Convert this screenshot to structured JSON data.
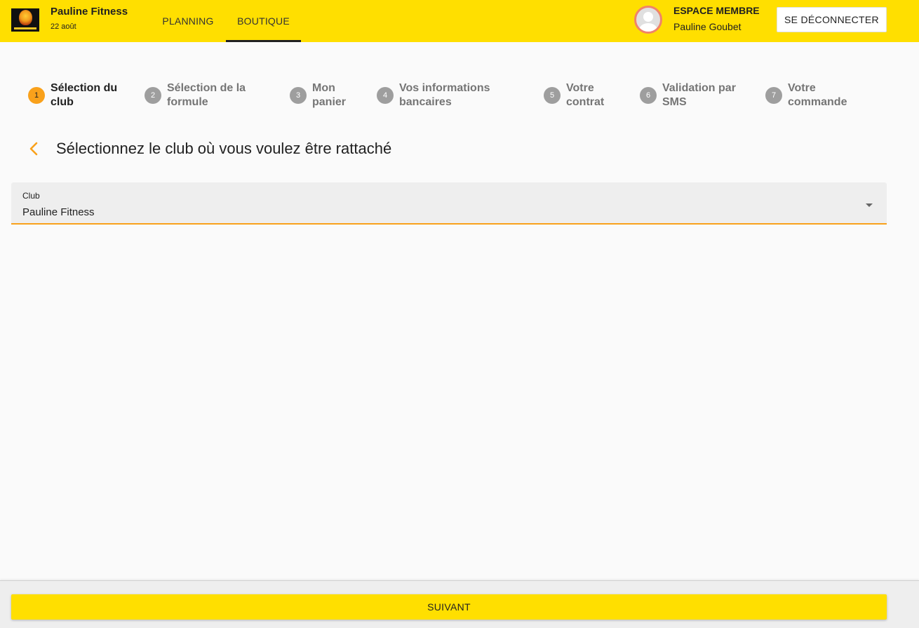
{
  "header": {
    "brand_name": "Pauline Fitness",
    "brand_date": "22 août",
    "nav": [
      {
        "label": "PLANNING",
        "active": false
      },
      {
        "label": "BOUTIQUE",
        "active": true
      }
    ],
    "member_title": "ESPACE MEMBRE",
    "member_name": "Pauline Goubet",
    "logout_label": "SE DÉCONNECTER"
  },
  "stepper": {
    "active_step": 1,
    "steps": [
      {
        "number": "1",
        "line1": "Sélection du",
        "line2": "club"
      },
      {
        "number": "2",
        "line1": "Sélection de la",
        "line2": "formule"
      },
      {
        "number": "3",
        "line1": "Mon",
        "line2": "panier"
      },
      {
        "number": "4",
        "line1": "Vos informations",
        "line2": "bancaires"
      },
      {
        "number": "5",
        "line1": "Votre",
        "line2": "contrat"
      },
      {
        "number": "6",
        "line1": "Validation par",
        "line2": "SMS"
      },
      {
        "number": "7",
        "line1": "Votre",
        "line2": "commande"
      }
    ]
  },
  "main": {
    "title": "Sélectionnez le club où vous voulez être rattaché",
    "club_field": {
      "label": "Club",
      "value": "Pauline Fitness"
    }
  },
  "footer": {
    "next_label": "SUIVANT"
  },
  "colors": {
    "brand_yellow": "#ffdf00",
    "accent_orange": "#f9a11b",
    "inactive_grey": "#9e9e9e"
  },
  "icons": {
    "logo": "lion-logo",
    "avatar": "user-avatar-icon",
    "back": "chevron-left-icon",
    "dropdown": "caret-down-icon"
  }
}
